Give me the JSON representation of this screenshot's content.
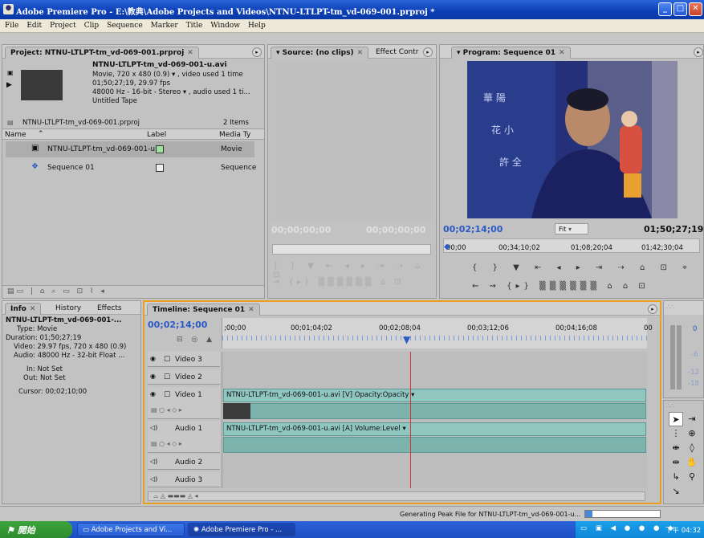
{
  "window": {
    "title": "Adobe Premiere Pro - E:\\教典\\Adobe Projects and Videos\\NTNU-LTLPT-tm_vd-069-001.prproj *",
    "minimize": "_",
    "maximize": "□",
    "close": "✕"
  },
  "menubar": [
    "File",
    "Edit",
    "Project",
    "Clip",
    "Sequence",
    "Marker",
    "Title",
    "Window",
    "Help"
  ],
  "project": {
    "tab": "Project: NTNU-LTLPT-tm_vd-069-001.prproj",
    "clip_name": "NTNU-LTLPT-tm_vd-069-001-u.avi",
    "clip_line1": "Movie, 720 x 480 (0.9)  ▾ , video used 1 time",
    "clip_line2": "01;50;27;19, 29.97 fps",
    "clip_line3": "48000 Hz - 16-bit - Stereo  ▾ , audio used 1 ti...",
    "clip_line4": "Untitled Tape",
    "project_file": "NTNU-LTLPT-tm_vd-069-001.prproj",
    "items_count": "2 Items",
    "columns": [
      "Name",
      "Label",
      "Media Ty"
    ],
    "rows": [
      {
        "name": "NTNU-LTLPT-tm_vd-069-001-u",
        "type": "Movie",
        "label_color": "#9be39b"
      },
      {
        "name": "Sequence 01",
        "type": "Sequence",
        "label_color": "#ffffff"
      }
    ]
  },
  "source": {
    "tab": "Source: (no clips)",
    "tab2": "Effect Contr",
    "timecode_left": "00;00;00;00",
    "timecode_right": "00;00;00;00"
  },
  "program": {
    "tab": "Program: Sequence 01",
    "timecode": "00;02;14;00",
    "fit": "Fit",
    "duration": "01;50;27;19",
    "ruler": [
      "00;00",
      "00;34;10;02",
      "01;08;20;04",
      "01;42;30;04"
    ]
  },
  "info": {
    "tabs": [
      "Info",
      "History",
      "Effects"
    ],
    "clip": "NTNU-LTLPT-tm_vd-069-001-...",
    "type": "Type: Movie",
    "duration": "Duration: 01;50;27;19",
    "video": "Video: 29.97 fps, 720 x 480 (0.9)",
    "audio": "Audio: 48000 Hz - 32-bit Float ...",
    "in": "In: Not Set",
    "out": "Out: Not Set",
    "cursor": "Cursor: 00;02;10;00"
  },
  "timeline": {
    "tab": "Timeline: Sequence 01",
    "timecode": "00;02;14;00",
    "ruler": [
      ";00;00",
      "00;01;04;02",
      "00;02;08;04",
      "00;03;12;06",
      "00;04;16;08",
      "00"
    ],
    "tracks": {
      "v3": "Video 3",
      "v2": "Video 2",
      "v1": "Video 1",
      "a1": "Audio 1",
      "a2": "Audio 2",
      "a3": "Audio 3"
    },
    "video_clip": "NTNU-LTLPT-tm_vd-069-001-u.avi [V]  Opacity:Opacity ▾",
    "audio_clip": "NTNU-LTLPT-tm_vd-069-001-u.avi [A]  Volume:Level ▾"
  },
  "meter": {
    "labels": [
      "0",
      "-6",
      "-12",
      "-18"
    ]
  },
  "status": {
    "text": "Generating Peak File for NTNU-LTLPT-tm_vd-069-001-u..."
  },
  "taskbar": {
    "start": "開始",
    "items": [
      "Adobe Projects and Vi...",
      "Adobe Premiere Pro - ..."
    ],
    "clock": "下午 04:32"
  }
}
